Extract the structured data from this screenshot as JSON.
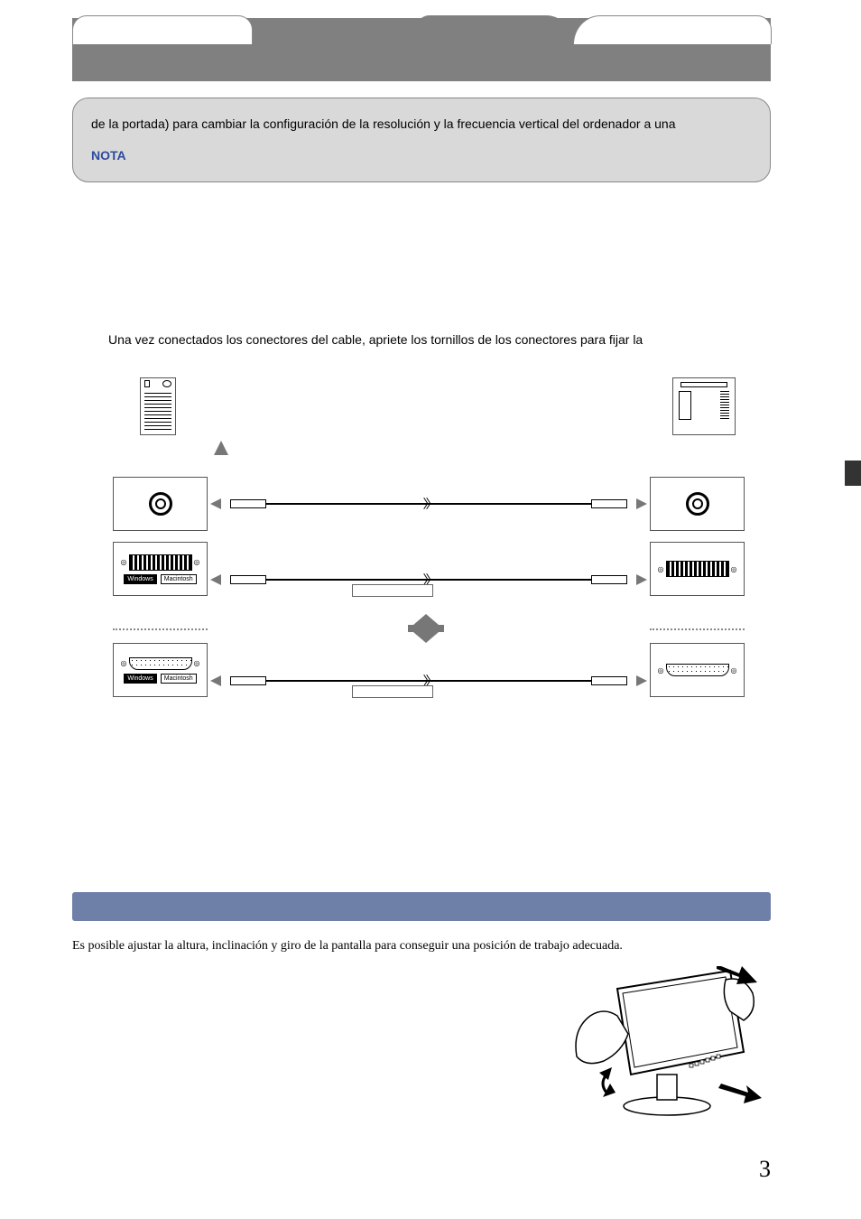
{
  "info_box": {
    "text": "de la portada) para cambiar la configuración de la resolución y la frecuencia vertical del ordenador a una",
    "nota_label": "NOTA"
  },
  "paragraph1": "Una vez conectados los conectores del cable, apriete los tornillos de los conectores para fijar la",
  "section_text": "Es posible ajustar la altura, inclinación y giro de la pantalla para conseguir una posición de trabajo adecuada.",
  "os_tags": {
    "windows": "Windows",
    "mac": "Macintosh"
  },
  "page_number": "3"
}
